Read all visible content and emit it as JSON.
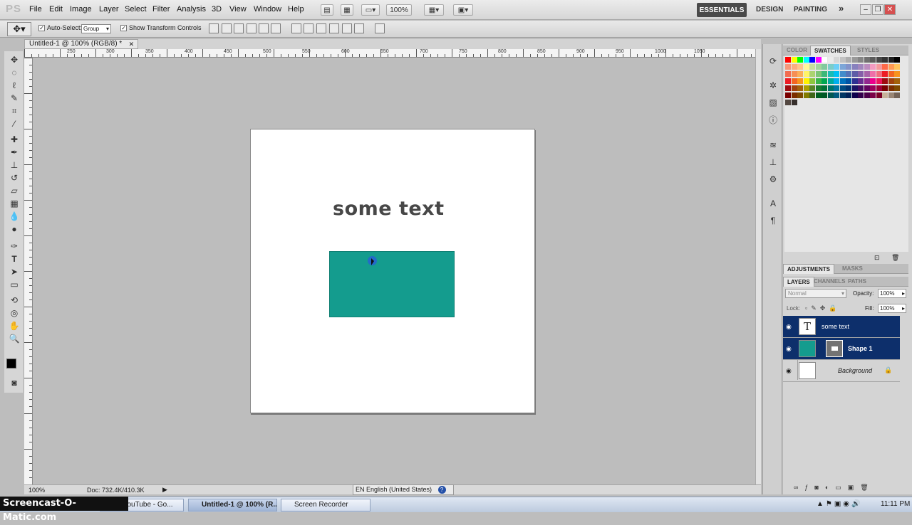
{
  "app": {
    "logo": "PS"
  },
  "menu": [
    "File",
    "Edit",
    "Image",
    "Layer",
    "Select",
    "Filter",
    "Analysis",
    "3D",
    "View",
    "Window",
    "Help"
  ],
  "appbar": {
    "zoom": "100%",
    "ws_active": "ESSENTIALS",
    "ws_design": "DESIGN",
    "ws_painting": "PAINTING",
    "more": "»"
  },
  "options": {
    "auto_select_label": "Auto-Select:",
    "auto_select_value": "Group",
    "show_transform": "Show Transform Controls"
  },
  "document": {
    "tab_title": "Untitled-1 @ 100% (RGB/8) *",
    "text_layer": "some text",
    "shape_color": "#149c8e"
  },
  "ruler_ticks": [
    "250",
    "300",
    "350",
    "400",
    "450",
    "500",
    "550",
    "600",
    "650",
    "700",
    "750",
    "800",
    "850",
    "900",
    "950",
    "1000",
    "1050"
  ],
  "status": {
    "zoom": "100%",
    "doc_size": "Doc: 732.4K/410.3K"
  },
  "color_panel": {
    "tabs": [
      "COLOR",
      "SWATCHES",
      "STYLES"
    ]
  },
  "adjust_panel": {
    "tabs": [
      "ADJUSTMENTS",
      "MASKS"
    ]
  },
  "layers_panel": {
    "tabs": [
      "LAYERS",
      "CHANNELS",
      "PATHS"
    ],
    "blend_mode": "Normal",
    "opacity_label": "Opacity:",
    "opacity": "100%",
    "lock_label": "Lock:",
    "fill_label": "Fill:",
    "fill": "100%",
    "layers": [
      {
        "name": "some text",
        "type": "text"
      },
      {
        "name": "Shape 1",
        "type": "shape"
      },
      {
        "name": "Background",
        "type": "background"
      }
    ]
  },
  "taskbar": {
    "items": [
      "s - YouTube - Go...",
      "Untitled-1 @ 100% (R...",
      "Screen Recorder"
    ],
    "language": "EN English (United States)",
    "time": "11:11 PM"
  },
  "watermark": "Screencast-O-Matic.com"
}
